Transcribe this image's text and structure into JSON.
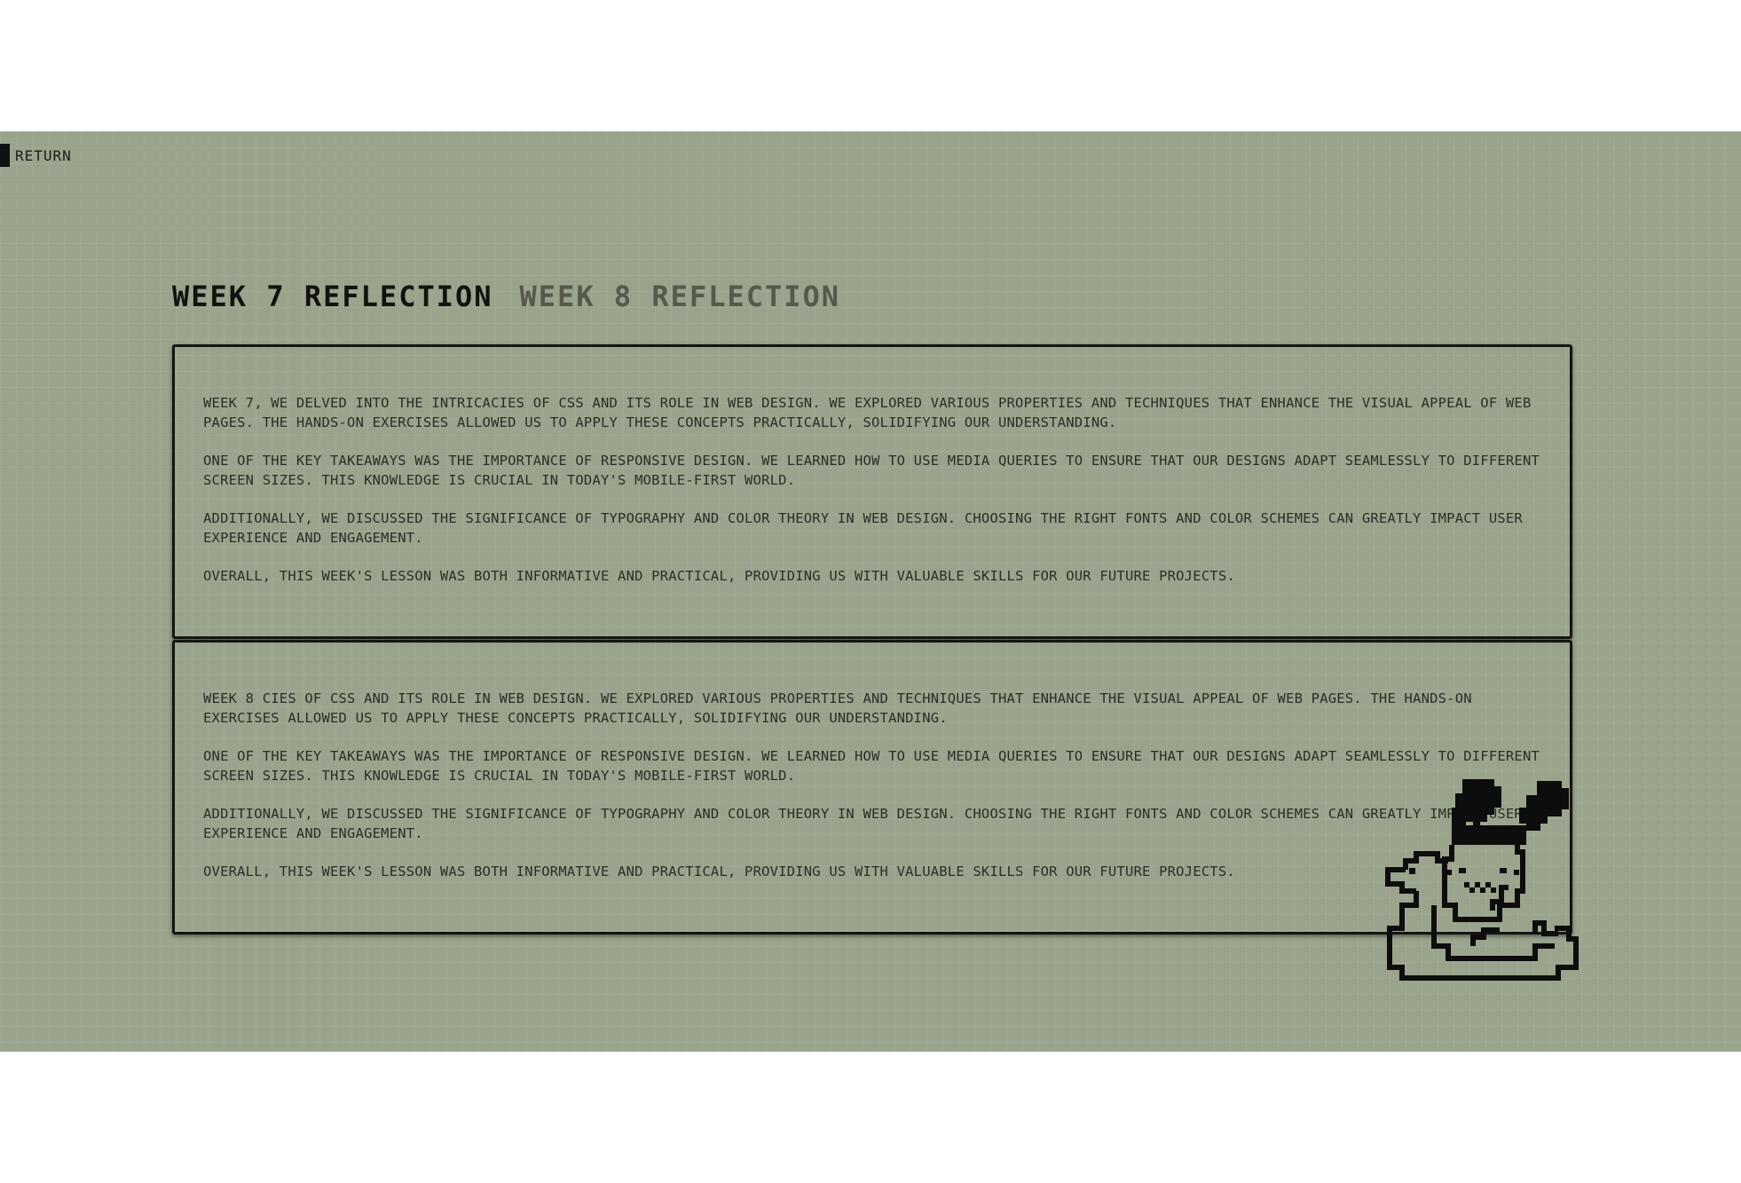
{
  "nav": {
    "return_label": "RETURN"
  },
  "tabs": [
    {
      "label": "WEEK 7 REFLECTION",
      "active": true
    },
    {
      "label": "WEEK 8 REFLECTION",
      "active": false
    }
  ],
  "panels": [
    {
      "paragraphs": [
        "WEEK 7, WE DELVED INTO THE INTRICACIES OF CSS AND ITS ROLE IN WEB DESIGN. WE EXPLORED VARIOUS PROPERTIES AND TECHNIQUES THAT ENHANCE THE VISUAL APPEAL OF WEB PAGES. THE HANDS-ON EXERCISES ALLOWED US TO APPLY THESE CONCEPTS PRACTICALLY, SOLIDIFYING OUR UNDERSTANDING.",
        "ONE OF THE KEY TAKEAWAYS WAS THE IMPORTANCE OF RESPONSIVE DESIGN. WE LEARNED HOW TO USE MEDIA QUERIES TO ENSURE THAT OUR DESIGNS ADAPT SEAMLESSLY TO DIFFERENT SCREEN SIZES. THIS KNOWLEDGE IS CRUCIAL IN TODAY'S MOBILE-FIRST WORLD.",
        "ADDITIONALLY, WE DISCUSSED THE SIGNIFICANCE OF TYPOGRAPHY AND COLOR THEORY IN WEB DESIGN. CHOOSING THE RIGHT FONTS AND COLOR SCHEMES CAN GREATLY IMPACT USER EXPERIENCE AND ENGAGEMENT.",
        "OVERALL, THIS WEEK'S LESSON WAS BOTH INFORMATIVE AND PRACTICAL, PROVIDING US WITH VALUABLE SKILLS FOR OUR FUTURE PROJECTS."
      ]
    },
    {
      "paragraphs": [
        "WEEK 8 CIES OF CSS AND ITS ROLE IN WEB DESIGN. WE EXPLORED VARIOUS PROPERTIES AND TECHNIQUES THAT ENHANCE THE VISUAL APPEAL OF WEB PAGES. THE HANDS-ON EXERCISES ALLOWED US TO APPLY THESE CONCEPTS PRACTICALLY, SOLIDIFYING OUR UNDERSTANDING.",
        "ONE OF THE KEY TAKEAWAYS WAS THE IMPORTANCE OF RESPONSIVE DESIGN. WE LEARNED HOW TO USE MEDIA QUERIES TO ENSURE THAT OUR DESIGNS ADAPT SEAMLESSLY TO DIFFERENT SCREEN SIZES. THIS KNOWLEDGE IS CRUCIAL IN TODAY'S MOBILE-FIRST WORLD.",
        "ADDITIONALLY, WE DISCUSSED THE SIGNIFICANCE OF TYPOGRAPHY AND COLOR THEORY IN WEB DESIGN. CHOOSING THE RIGHT FONTS AND COLOR SCHEMES CAN GREATLY IMPACT USER EXPERIENCE AND ENGAGEMENT.",
        "OVERALL, THIS WEEK'S LESSON WAS BOTH INFORMATIVE AND PRACTICAL, PROVIDING US WITH VALUABLE SKILLS FOR OUR FUTURE PROJECTS."
      ]
    }
  ],
  "mascot": {
    "icon": "pixel-bunny-duck-float-icon"
  },
  "colors": {
    "lcd_background": "#9aa38c",
    "ink": "#111310",
    "inactive_ink": "#555a4c"
  }
}
